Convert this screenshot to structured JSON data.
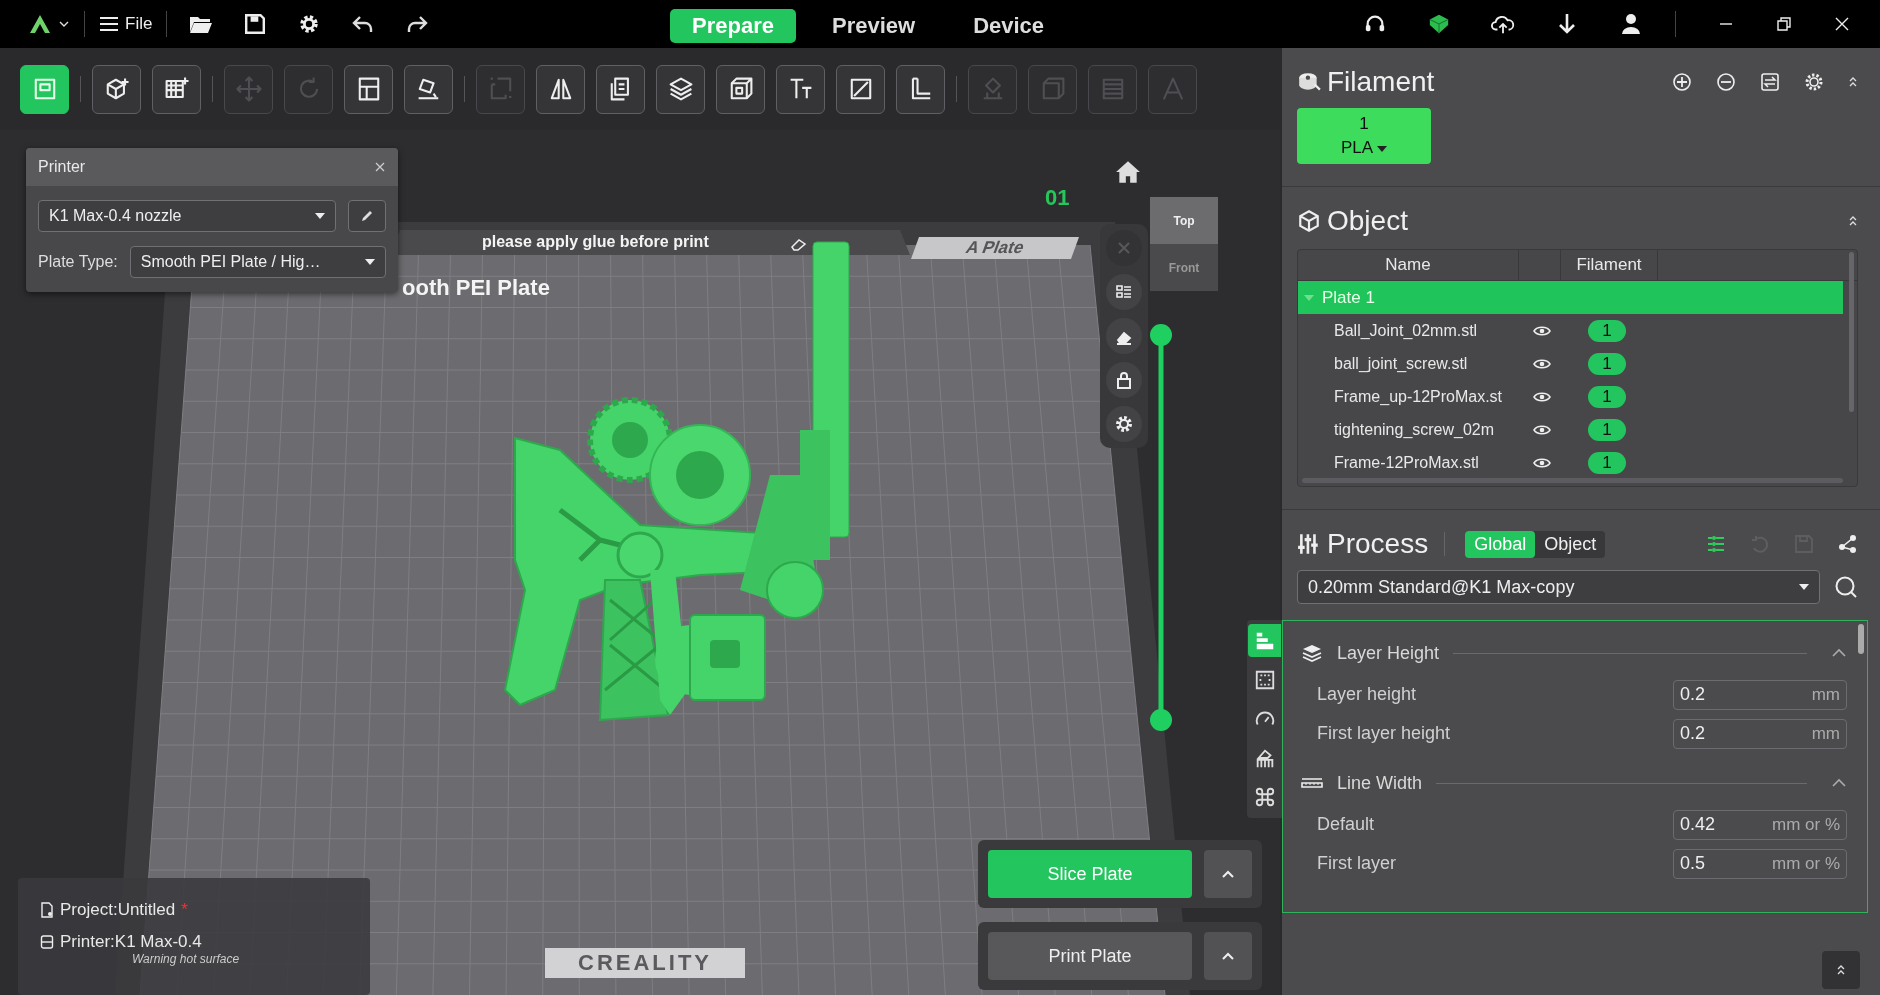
{
  "title_bar": {
    "menu": "File",
    "tabs": [
      {
        "label": "Prepare",
        "selected": true
      },
      {
        "label": "Preview",
        "selected": false
      },
      {
        "label": "Device",
        "selected": false
      }
    ]
  },
  "toolbar": {
    "groups": [
      [
        {
          "selected": true,
          "disabled": false
        }
      ],
      [
        {
          "selected": false,
          "disabled": false
        },
        {
          "selected": false,
          "disabled": false
        }
      ],
      [
        {
          "selected": false,
          "disabled": true
        },
        {
          "selected": false,
          "disabled": true
        },
        {
          "selected": false,
          "disabled": false
        },
        {
          "selected": false,
          "disabled": false
        }
      ],
      [
        {
          "selected": false,
          "disabled": true
        },
        {
          "selected": false,
          "disabled": false
        },
        {
          "selected": false,
          "disabled": false
        },
        {
          "selected": false,
          "disabled": false
        },
        {
          "selected": false,
          "disabled": false
        },
        {
          "selected": false,
          "disabled": false
        },
        {
          "selected": false,
          "disabled": false
        },
        {
          "selected": false,
          "disabled": false
        }
      ],
      [
        {
          "selected": false,
          "disabled": true
        },
        {
          "selected": false,
          "disabled": true
        },
        {
          "selected": false,
          "disabled": true
        },
        {
          "selected": false,
          "disabled": true
        }
      ]
    ]
  },
  "printer_panel": {
    "title": "Printer",
    "printer": "K1 Max-0.4 nozzle",
    "plate_type_label": "Plate Type:",
    "plate_type": "Smooth PEI Plate / Hig…"
  },
  "plate": {
    "notice": "please apply glue before print",
    "name": "A Plate",
    "plate_type": "ooth PEI Plate",
    "number": "01",
    "brand": "CREALITY",
    "warning": "Warning hot surface"
  },
  "view_cube": {
    "faces": [
      "Top",
      "Front"
    ]
  },
  "side_tools": [
    {
      "disabled": true
    },
    {
      "disabled": false
    },
    {
      "disabled": false
    },
    {
      "disabled": false
    },
    {
      "disabled": false
    }
  ],
  "layer_slider": {
    "level": 1
  },
  "project_info": {
    "project": "Project:Untitled",
    "modified_mark": "*",
    "printer": "Printer:K1 Max-0.4"
  },
  "actions": [
    {
      "label": "Slice Plate",
      "primary": true
    },
    {
      "label": "Print Plate",
      "primary": false
    }
  ],
  "filament": {
    "title": "Filament",
    "slots": [
      {
        "number": "1",
        "material": "PLA",
        "color": "#3ddc5c"
      }
    ]
  },
  "object": {
    "title": "Object",
    "name_header": "Name",
    "filament_header": "Filament",
    "plates": [
      {
        "name": "Plate 1",
        "selected": true,
        "expanded": true,
        "children": [
          {
            "name": "Ball_Joint_02mm.stl",
            "visible": true,
            "filament": "1"
          },
          {
            "name": "ball_joint_screw.stl",
            "visible": true,
            "filament": "1"
          },
          {
            "name": "Frame_up-12ProMax.st",
            "visible": true,
            "filament": "1"
          },
          {
            "name": "tightening_screw_02m",
            "visible": true,
            "filament": "1"
          },
          {
            "name": "Frame-12ProMax.stl",
            "visible": true,
            "filament": "1"
          }
        ]
      }
    ]
  },
  "process": {
    "title": "Process",
    "modes": [
      {
        "label": "Global",
        "selected": true
      },
      {
        "label": "Object",
        "selected": false
      }
    ],
    "preset": "0.20mm Standard@K1 Max-copy",
    "category_tabs": [
      {
        "selected": true
      },
      {
        "selected": false
      },
      {
        "selected": false
      },
      {
        "selected": false
      },
      {
        "selected": false
      }
    ],
    "groups": [
      {
        "title": "Layer Height",
        "kind": "layers",
        "expanded": true,
        "settings": [
          {
            "label": "Layer height",
            "value": "0.2",
            "unit": "mm"
          },
          {
            "label": "First layer height",
            "value": "0.2",
            "unit": "mm"
          }
        ]
      },
      {
        "title": "Line Width",
        "kind": "ruler",
        "expanded": true,
        "settings": [
          {
            "label": "Default",
            "value": "0.42",
            "unit": "mm or %"
          },
          {
            "label": "First layer",
            "value": "0.5",
            "unit": "mm or %"
          }
        ]
      }
    ]
  }
}
